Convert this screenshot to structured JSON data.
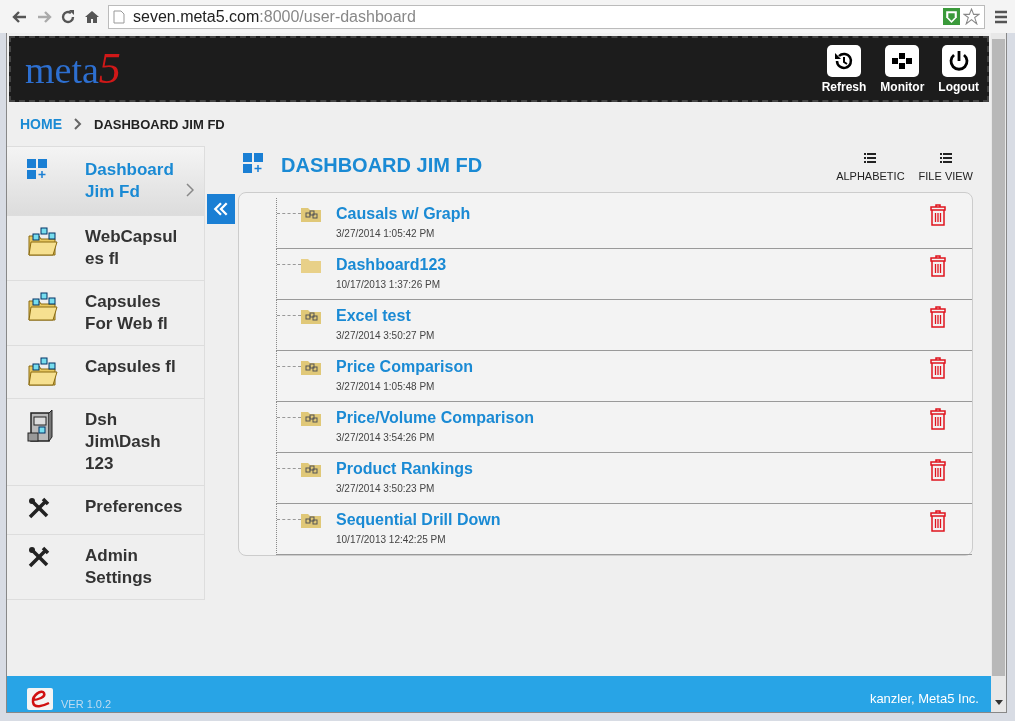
{
  "browser": {
    "url_host": "seven.meta5.com",
    "url_path": ":8000/user-dashboard"
  },
  "header": {
    "logo": "meta",
    "logo_accent": "5",
    "buttons": [
      {
        "label": "Refresh",
        "kind": "refresh"
      },
      {
        "label": "Monitor",
        "kind": "monitor"
      },
      {
        "label": "Logout",
        "kind": "logout"
      }
    ]
  },
  "breadcrumb": {
    "home": "HOME",
    "current": "DASHBOARD JIM FD"
  },
  "sidebar": {
    "items": [
      {
        "label": "Dashboard Jim Fd",
        "kind": "dashboard",
        "selected": true
      },
      {
        "label": "WebCapsul es fl",
        "kind": "capsules",
        "selected": false
      },
      {
        "label": "Capsules For Web fl",
        "kind": "capsules",
        "selected": false
      },
      {
        "label": "Capsules fl",
        "kind": "capsules",
        "selected": false
      },
      {
        "label": "Dsh Jim\\Dash 123",
        "kind": "cabinet",
        "selected": false
      },
      {
        "label": "Preferences",
        "kind": "tools",
        "selected": false
      },
      {
        "label": "Admin Settings",
        "kind": "tools",
        "selected": false
      }
    ]
  },
  "content": {
    "title": "DASHBOARD JIM FD",
    "views": [
      "ALPHABETIC",
      "FILE VIEW"
    ],
    "items": [
      {
        "name": "Causals w/ Graph",
        "date": "3/27/2014 1:05:42 PM",
        "kind": "capsule"
      },
      {
        "name": "Dashboard123",
        "date": "10/17/2013 1:37:26 PM",
        "kind": "folder"
      },
      {
        "name": "Excel test",
        "date": "3/27/2014 3:50:27 PM",
        "kind": "capsule"
      },
      {
        "name": "Price Comparison",
        "date": "3/27/2014 1:05:48 PM",
        "kind": "capsule"
      },
      {
        "name": "Price/Volume Comparison",
        "date": "3/27/2014 3:54:26 PM",
        "kind": "capsule"
      },
      {
        "name": "Product Rankings",
        "date": "3/27/2014 3:50:23 PM",
        "kind": "capsule"
      },
      {
        "name": "Sequential Drill Down",
        "date": "10/17/2013 12:42:25 PM",
        "kind": "capsule"
      }
    ]
  },
  "footer": {
    "version": "VER 1.0.2",
    "company": "kanzler, Meta5 Inc."
  }
}
